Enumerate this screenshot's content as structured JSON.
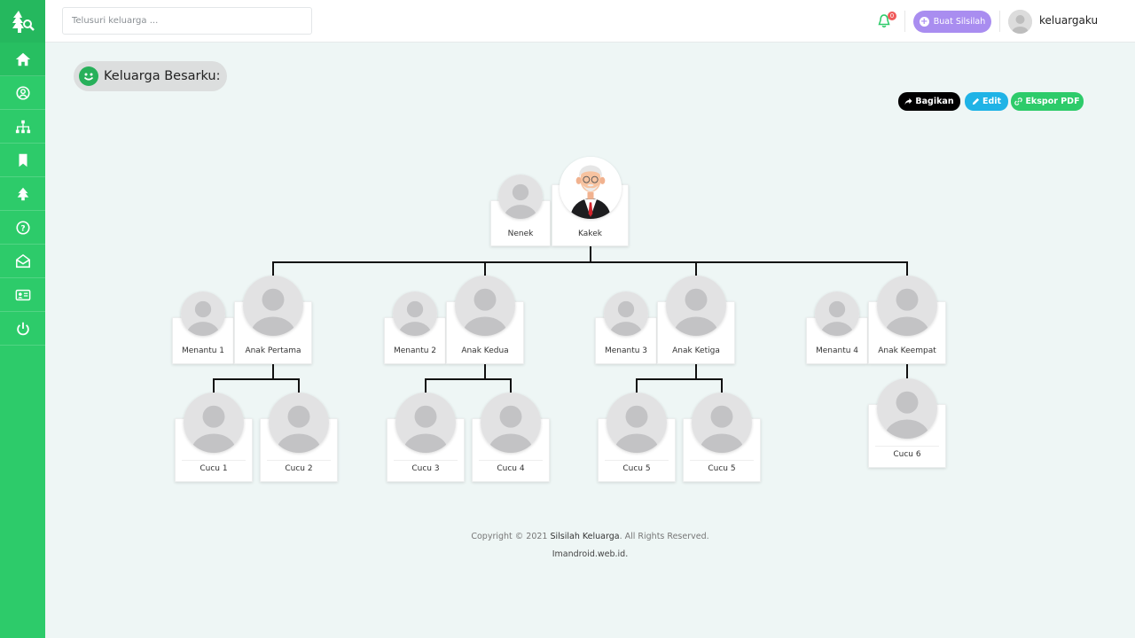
{
  "topbar": {
    "search_placeholder": "Telusuri keluarga ...",
    "notification_count": "0",
    "create_button": "Buat Silsilah",
    "username": "keluargaku"
  },
  "sidebar": {
    "items": [
      "home-icon",
      "user-circle-icon",
      "sitemap-icon",
      "bookmark-icon",
      "family-icon",
      "help-icon",
      "envelope-open-icon",
      "id-card-icon",
      "power-icon"
    ]
  },
  "page": {
    "title": "Keluarga Besarku:"
  },
  "actions": {
    "share": "Bagikan",
    "edit": "Edit",
    "export": "Ekspor PDF"
  },
  "tree": {
    "grandparents": {
      "spouse": "Nenek",
      "main": "Kakek"
    },
    "children": [
      {
        "spouse": "Menantu 1",
        "main": "Anak Pertama",
        "kids": [
          "Cucu 1",
          "Cucu 2"
        ]
      },
      {
        "spouse": "Menantu 2",
        "main": "Anak Kedua",
        "kids": [
          "Cucu 3",
          "Cucu 4"
        ]
      },
      {
        "spouse": "Menantu 3",
        "main": "Anak Ketiga",
        "kids": [
          "Cucu 5",
          "Cucu 5"
        ]
      },
      {
        "spouse": "Menantu 4",
        "main": "Anak Keempat",
        "kids": [
          "Cucu 6"
        ]
      }
    ]
  },
  "footer": {
    "copyright_prefix": "Copyright © 2021 ",
    "brand": "Silsilah Keluarga",
    "copyright_suffix": ". All Rights Reserved.",
    "site": "Imandroid.web.id."
  },
  "colors": {
    "sidebar": "#2dcb6a",
    "create_button": "#a98df0",
    "share_button": "#000000",
    "edit_button": "#1fb3e6",
    "export_button": "#2dcb6a"
  }
}
